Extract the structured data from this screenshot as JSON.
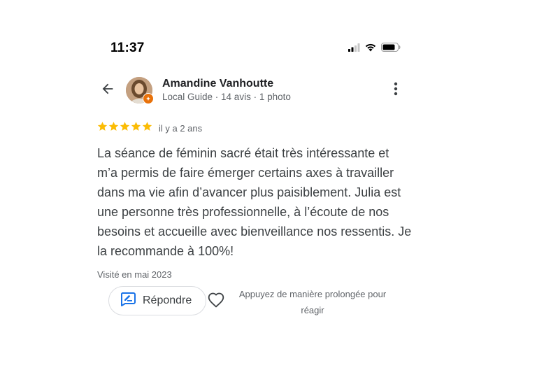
{
  "status_bar": {
    "time": "11:37",
    "icons": [
      "cellular-signal-icon",
      "wifi-icon",
      "battery-icon"
    ]
  },
  "header": {
    "back_icon": "arrow-back-icon",
    "author_name": "Amandine Vanhoutte",
    "author_meta": "Local Guide · 14 avis · 1 photo",
    "badge_icon": "local-guide-badge-icon",
    "more_icon": "more-vert-icon"
  },
  "review": {
    "rating": 5,
    "max_rating": 5,
    "date": "il y a 2 ans",
    "text": "La séance de féminin sacré était très intéressante et m’a permis de faire émerger certains axes à travailler dans ma vie afin d’avancer plus paisiblement. Julia est une personne très professionnelle, à l’écoute de nos besoins et accueille avec bienveillance nos ressentis. Je la recommande à 100%!",
    "visited": "Visité en mai 2023"
  },
  "actions": {
    "reply_label": "Répondre",
    "reply_icon": "reply-edit-icon",
    "heart_icon": "heart-outline-icon",
    "react_hint": "Appuyez de manière prolongée pour réagir"
  },
  "colors": {
    "star": "#fbbc04",
    "accent_blue": "#1a73e8",
    "badge_orange": "#e8710a",
    "text_primary": "#202124",
    "text_secondary": "#5f6368"
  }
}
